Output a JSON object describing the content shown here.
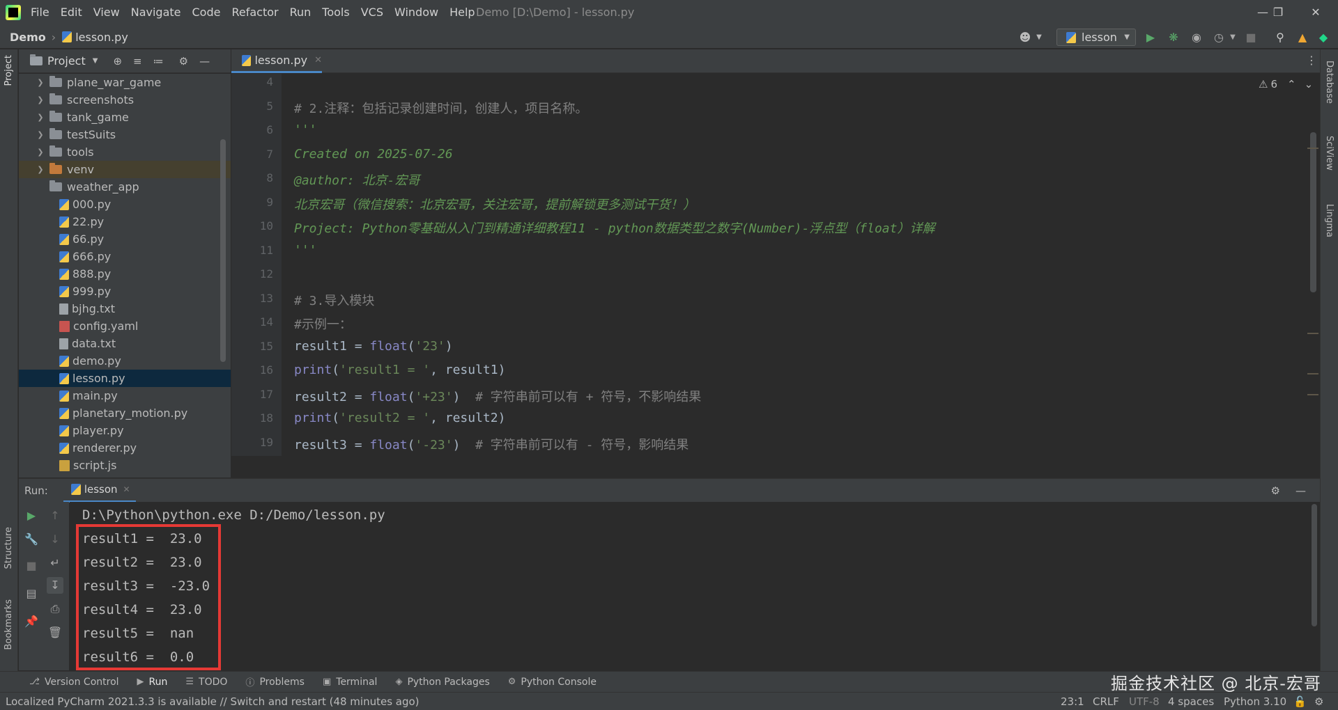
{
  "menu": [
    "File",
    "Edit",
    "View",
    "Navigate",
    "Code",
    "Refactor",
    "Run",
    "Tools",
    "VCS",
    "Window",
    "Help"
  ],
  "window_title": "Demo [D:\\Demo] - lesson.py",
  "breadcrumb": {
    "project": "Demo",
    "file": "lesson.py"
  },
  "run_config": "lesson",
  "project_panel": {
    "title": "Project",
    "tree": [
      {
        "label": "plane_war_game",
        "kind": "folder"
      },
      {
        "label": "screenshots",
        "kind": "folder"
      },
      {
        "label": "tank_game",
        "kind": "folder"
      },
      {
        "label": "testSuits",
        "kind": "folder"
      },
      {
        "label": "tools",
        "kind": "folder"
      },
      {
        "label": "venv",
        "kind": "folder-venv"
      },
      {
        "label": "weather_app",
        "kind": "folder-leaf"
      },
      {
        "label": "000.py",
        "kind": "py"
      },
      {
        "label": "22.py",
        "kind": "py"
      },
      {
        "label": "66.py",
        "kind": "py"
      },
      {
        "label": "666.py",
        "kind": "py"
      },
      {
        "label": "888.py",
        "kind": "py"
      },
      {
        "label": "999.py",
        "kind": "py"
      },
      {
        "label": "bjhg.txt",
        "kind": "txt"
      },
      {
        "label": "config.yaml",
        "kind": "yml"
      },
      {
        "label": "data.txt",
        "kind": "txt"
      },
      {
        "label": "demo.py",
        "kind": "py"
      },
      {
        "label": "lesson.py",
        "kind": "py",
        "selected": true
      },
      {
        "label": "main.py",
        "kind": "py"
      },
      {
        "label": "planetary_motion.py",
        "kind": "py"
      },
      {
        "label": "player.py",
        "kind": "py"
      },
      {
        "label": "renderer.py",
        "kind": "py"
      },
      {
        "label": "script.js",
        "kind": "js"
      }
    ]
  },
  "editor": {
    "tab": "lesson.py",
    "inspection_count": "6",
    "lines": [
      {
        "n": "4",
        "parts": []
      },
      {
        "n": "5",
        "parts": [
          {
            "t": "# 2.注释：包括记录创建时间，创建人，项目名称。",
            "c": "c-cmt"
          }
        ]
      },
      {
        "n": "6",
        "parts": [
          {
            "t": "'''",
            "c": "c-doc"
          }
        ]
      },
      {
        "n": "7",
        "parts": [
          {
            "t": "Created on 2025-07-26",
            "c": "c-doc"
          }
        ]
      },
      {
        "n": "8",
        "parts": [
          {
            "t": "@author: 北京-宏哥",
            "c": "c-doc"
          }
        ]
      },
      {
        "n": "9",
        "parts": [
          {
            "t": "北京宏哥（微信搜索：北京宏哥，关注宏哥，提前解锁更多测试干货！）",
            "c": "c-doc"
          }
        ]
      },
      {
        "n": "10",
        "parts": [
          {
            "t": "Project: Python零基础从入门到精通详细教程11 - python数据类型之数字(Number)-浮点型（float）详解",
            "c": "c-doc"
          }
        ]
      },
      {
        "n": "11",
        "parts": [
          {
            "t": "'''",
            "c": "c-doc"
          }
        ]
      },
      {
        "n": "12",
        "parts": []
      },
      {
        "n": "13",
        "parts": [
          {
            "t": "# 3.导入模块",
            "c": "c-cmt"
          }
        ]
      },
      {
        "n": "14",
        "parts": [
          {
            "t": "#示例一：",
            "c": "c-cmt"
          }
        ]
      },
      {
        "n": "15",
        "parts": [
          {
            "t": "result1 = ",
            "c": ""
          },
          {
            "t": "float",
            "c": "c-fn"
          },
          {
            "t": "(",
            "c": ""
          },
          {
            "t": "'23'",
            "c": "c-str"
          },
          {
            "t": ")",
            "c": ""
          }
        ]
      },
      {
        "n": "16",
        "parts": [
          {
            "t": "print",
            "c": "c-fn"
          },
          {
            "t": "(",
            "c": ""
          },
          {
            "t": "'result1 = '",
            "c": "c-str"
          },
          {
            "t": ", result1)",
            "c": ""
          }
        ]
      },
      {
        "n": "17",
        "parts": [
          {
            "t": "result2 = ",
            "c": ""
          },
          {
            "t": "float",
            "c": "c-fn"
          },
          {
            "t": "(",
            "c": ""
          },
          {
            "t": "'+23'",
            "c": "c-str"
          },
          {
            "t": ")  ",
            "c": ""
          },
          {
            "t": "# 字符串前可以有 + 符号，不影响结果",
            "c": "c-cmt"
          }
        ]
      },
      {
        "n": "18",
        "parts": [
          {
            "t": "print",
            "c": "c-fn"
          },
          {
            "t": "(",
            "c": ""
          },
          {
            "t": "'result2 = '",
            "c": "c-str"
          },
          {
            "t": ", result2)",
            "c": ""
          }
        ]
      },
      {
        "n": "19",
        "parts": [
          {
            "t": "result3 = ",
            "c": ""
          },
          {
            "t": "float",
            "c": "c-fn"
          },
          {
            "t": "(",
            "c": ""
          },
          {
            "t": "'-23'",
            "c": "c-str"
          },
          {
            "t": ")  ",
            "c": ""
          },
          {
            "t": "# 字符串前可以有 - 符号，影响结果",
            "c": "c-cmt"
          }
        ]
      }
    ]
  },
  "run_panel": {
    "label": "Run:",
    "tab": "lesson",
    "command": "D:\\Python\\python.exe D:/Demo/lesson.py",
    "output": [
      "result1 =  23.0",
      "result2 =  23.0",
      "result3 =  -23.0",
      "result4 =  23.0",
      "result5 =  nan",
      "result6 =  0.0"
    ]
  },
  "bottom_tools": [
    {
      "label": "Version Control",
      "icon": "branch-icon"
    },
    {
      "label": "Run",
      "icon": "run-icon",
      "active": true
    },
    {
      "label": "TODO",
      "icon": "list-icon"
    },
    {
      "label": "Problems",
      "icon": "info-icon"
    },
    {
      "label": "Terminal",
      "icon": "terminal-icon"
    },
    {
      "label": "Python Packages",
      "icon": "packages-icon"
    },
    {
      "label": "Python Console",
      "icon": "console-icon"
    }
  ],
  "side_labels": {
    "project": "Project",
    "structure": "Structure",
    "bookmarks": "Bookmarks",
    "database": "Database",
    "sciview": "SciView",
    "lingma": "Lingma"
  },
  "watermark": "掘金技术社区 @ 北京-宏哥",
  "status": {
    "message": "Localized PyCharm 2021.3.3 is available // Switch and restart (48 minutes ago)",
    "position": "23:1",
    "line_sep": "CRLF",
    "encoding": "UTF-8",
    "indent": "4 spaces",
    "interpreter": "Python 3.10"
  },
  "colors": {
    "accent": "#4a88c7",
    "highlight_box": "#e53935",
    "selection": "#0d293e"
  }
}
